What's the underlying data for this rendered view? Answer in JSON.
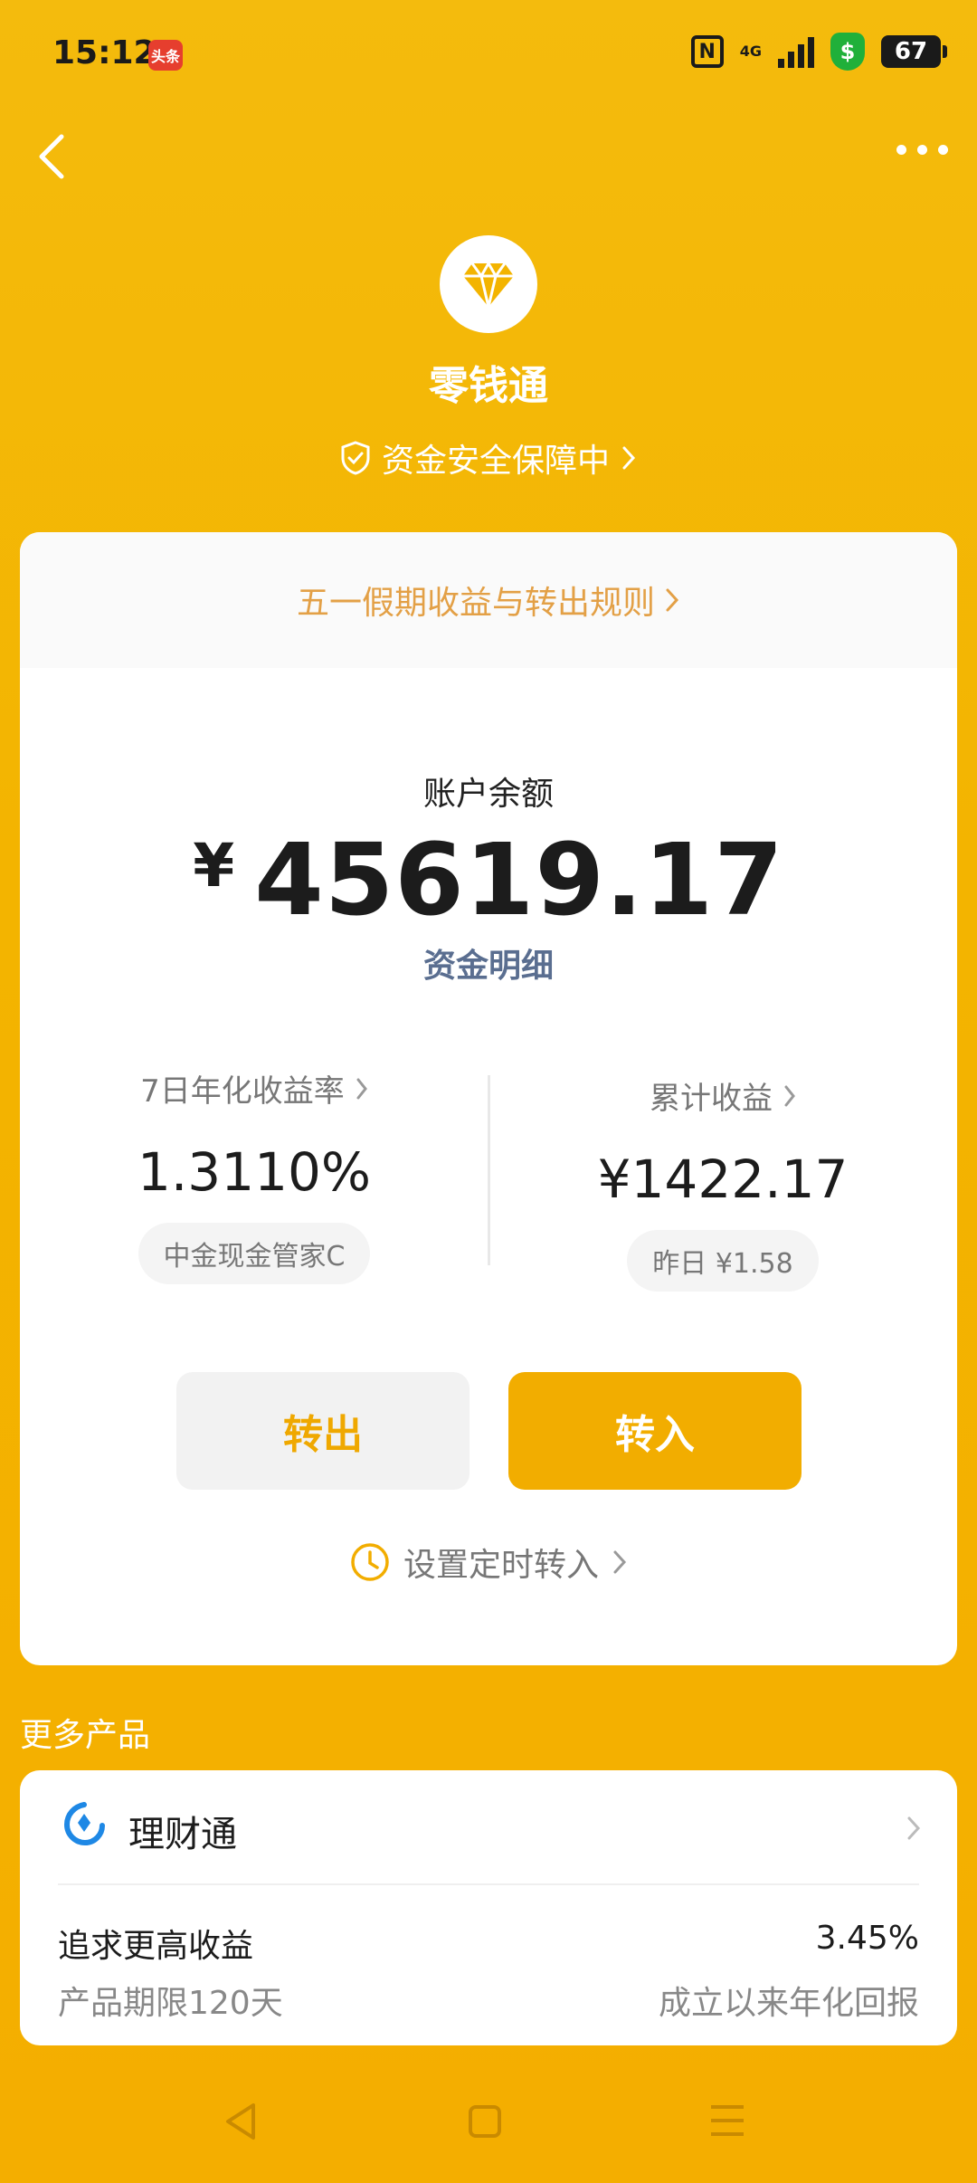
{
  "status_bar": {
    "time": "15:12",
    "app_badge": "头条",
    "nfc": "N",
    "network": "4G",
    "battery": "67",
    "shield_glyph": "$"
  },
  "header": {
    "title": "零钱通",
    "security_text": "资金安全保障中",
    "back_icon": "chevron-left-icon",
    "more_icon": "more-dots-icon",
    "logo_icon": "diamond-icon"
  },
  "notice": {
    "text": "五一假期收益与转出规则"
  },
  "balance": {
    "label": "账户余额",
    "currency": "¥",
    "amount": "45619.17",
    "detail_link": "资金明细"
  },
  "stats": {
    "yield": {
      "label": "7日年化收益率",
      "value": "1.3110%",
      "chip": "中金现金管家C"
    },
    "income": {
      "label": "累计收益",
      "value": "¥1422.17",
      "chip": "昨日 ¥1.58"
    }
  },
  "actions": {
    "transfer_out": "转出",
    "transfer_in": "转入",
    "schedule": "设置定时转入"
  },
  "more_products": {
    "title": "更多产品",
    "product": {
      "name": "理财通",
      "left_line1": "追求更高收益",
      "left_line2": "产品期限120天",
      "right_line1": "3.45%",
      "right_line2": "成立以来年化回报"
    }
  },
  "colors": {
    "background": "#F3B400",
    "accent": "#F2AD00",
    "notice_text": "#E3A046",
    "link": "#5A6E90"
  }
}
